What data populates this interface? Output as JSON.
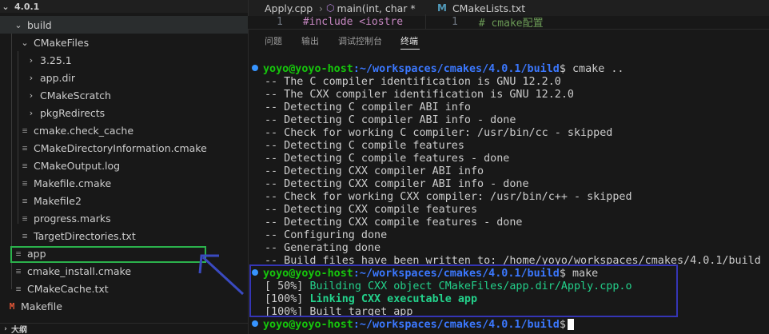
{
  "explorer": {
    "root_label": "4.0.1",
    "items": [
      {
        "label": "build",
        "chevron": "⌄",
        "icon": ""
      },
      {
        "label": "CMakeFiles",
        "chevron": "⌄",
        "icon": ""
      },
      {
        "label": "3.25.1",
        "chevron": "›",
        "icon": ""
      },
      {
        "label": "app.dir",
        "chevron": "›",
        "icon": ""
      },
      {
        "label": "CMakeScratch",
        "chevron": "›",
        "icon": ""
      },
      {
        "label": "pkgRedirects",
        "chevron": "›",
        "icon": ""
      },
      {
        "label": "cmake.check_cache",
        "chevron": "",
        "icon": "≡"
      },
      {
        "label": "CMakeDirectoryInformation.cmake",
        "chevron": "",
        "icon": "≡"
      },
      {
        "label": "CMakeOutput.log",
        "chevron": "",
        "icon": "≡"
      },
      {
        "label": "Makefile.cmake",
        "chevron": "",
        "icon": "≡"
      },
      {
        "label": "Makefile2",
        "chevron": "",
        "icon": "≡"
      },
      {
        "label": "progress.marks",
        "chevron": "",
        "icon": "≡"
      },
      {
        "label": "TargetDirectories.txt",
        "chevron": "",
        "icon": "≡"
      },
      {
        "label": "app",
        "chevron": "",
        "icon": "≡"
      },
      {
        "label": "cmake_install.cmake",
        "chevron": "",
        "icon": "≡"
      },
      {
        "label": "CMakeCache.txt",
        "chevron": "",
        "icon": "≡"
      },
      {
        "label": "Makefile",
        "chevron": "",
        "icon": "M"
      }
    ],
    "outline_label": "大纲"
  },
  "editor": {
    "tab1_label": "Apply.cpp",
    "tab1_breadcrumb": "main(int, char *",
    "tab1_line_no": "1",
    "tab1_code": "#include <iostre",
    "tab2_label": "CMakeLists.txt",
    "tab2_line_no": "1",
    "tab2_code": "# cmake配置",
    "accent_color": "#519aba",
    "cmake_icon": "M"
  },
  "panel": {
    "tabs": [
      "问题",
      "输出",
      "调试控制台",
      "终端"
    ],
    "active_tab": "终端"
  },
  "terminal": {
    "user_host": "yoyo@yoyo-host",
    "path": ":~/workspaces/cmakes/4.0.1/build",
    "prompt_suffix": "$",
    "cmd1": " cmake ..",
    "cmake_output": [
      "-- The C compiler identification is GNU 12.2.0",
      "-- The CXX compiler identification is GNU 12.2.0",
      "-- Detecting C compiler ABI info",
      "-- Detecting C compiler ABI info - done",
      "-- Check for working C compiler: /usr/bin/cc - skipped",
      "-- Detecting C compile features",
      "-- Detecting C compile features - done",
      "-- Detecting CXX compiler ABI info",
      "-- Detecting CXX compiler ABI info - done",
      "-- Check for working CXX compiler: /usr/bin/c++ - skipped",
      "-- Detecting CXX compile features",
      "-- Detecting CXX compile features - done",
      "-- Configuring done",
      "-- Generating done",
      "-- Build files have been written to: /home/yoyo/workspaces/cmakes/4.0.1/build"
    ],
    "cmd2": " make",
    "make_line1_prefix": "[ 50%] ",
    "make_line1_text": "Building CXX object CMakeFiles/app.dir/Apply.cpp.o",
    "make_line2_prefix": "[100%] ",
    "make_line2_text": "Linking CXX executable app",
    "make_line3": "[100%] Built target app",
    "prompt_dot_color": "#3794ff",
    "user_color": "#16c60c",
    "path_color": "#3b78ff",
    "success_color": "#23d18b"
  },
  "annotations": {
    "selection_box_color": "#2bb24c",
    "highlight_box_color": "#3535b5",
    "arrow_color": "#3a4ac0"
  }
}
